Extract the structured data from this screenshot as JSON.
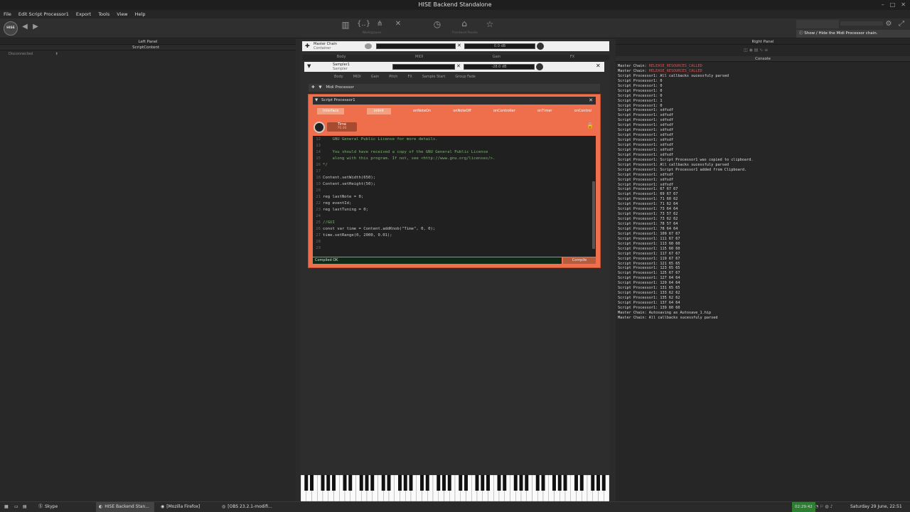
{
  "window": {
    "title": "HISE Backend Standalone"
  },
  "menu": [
    "File",
    "Edit Script Processor1",
    "Export",
    "Tools",
    "View",
    "Help"
  ],
  "toolbar": {
    "logo": "HISE",
    "workspaces_label": "Workspaces",
    "frontend_label": "Frontend Panels",
    "tooltip": "Show / Hide the Midi Processor chain."
  },
  "left_panel": {
    "title": "Left Panel",
    "subtitle": "ScriptContent",
    "status": "Disconnected"
  },
  "right_panel": {
    "title": "Right Panel",
    "console_title": "Console"
  },
  "master_chain": {
    "name": "Master Chain",
    "type": "Container",
    "gain": "0.0 dB",
    "tabs": [
      "Body",
      "MIDI",
      "Gain",
      "FX"
    ]
  },
  "sampler": {
    "name": "Sampler1",
    "type": "Sampler",
    "gain": "-28.0 dB",
    "tabs": [
      "Body",
      "MIDI",
      "Gain",
      "Pitch",
      "FX",
      "Sample Start",
      "Group Fade"
    ]
  },
  "midi_processor": {
    "label": "Midi Processor"
  },
  "script_processor": {
    "name": "Script Processor1",
    "tabs": [
      "Interface",
      "onInit",
      "onNoteOn",
      "onNoteOff",
      "onController",
      "onTimer",
      "onControl"
    ],
    "knob_label": "Time",
    "knob_value": "70.00",
    "status": "Compiled OK",
    "compile_label": "Compile"
  },
  "code_lines": [
    {
      "n": "12",
      "t": "    GNU General Public License for more details.",
      "cls": "c"
    },
    {
      "n": "13",
      "t": "",
      "cls": "c"
    },
    {
      "n": "14",
      "t": "    You should have received a copy of the GNU General Public License",
      "cls": "c"
    },
    {
      "n": "15",
      "t": "    along with this program. If not, see <http://www.gnu.org/licenses/>.",
      "cls": "c"
    },
    {
      "n": "16",
      "t": "*/",
      "cls": "c"
    },
    {
      "n": "17",
      "t": "",
      "cls": "k"
    },
    {
      "n": "18",
      "t": "Content.setWidth(650);",
      "cls": "k"
    },
    {
      "n": "19",
      "t": "Content.setHeight(50);",
      "cls": "k"
    },
    {
      "n": "20",
      "t": "",
      "cls": "k"
    },
    {
      "n": "21",
      "t": "reg lastNote = 0;",
      "cls": "k"
    },
    {
      "n": "22",
      "t": "reg eventId;",
      "cls": "k"
    },
    {
      "n": "23",
      "t": "reg lastTuning = 0;",
      "cls": "k"
    },
    {
      "n": "24",
      "t": "",
      "cls": "k"
    },
    {
      "n": "25",
      "t": "//GUI",
      "cls": "c"
    },
    {
      "n": "26",
      "t": "const var time = Content.addKnob(\"Time\", 0, 0);",
      "cls": "k"
    },
    {
      "n": "27",
      "t": "time.setRange(0, 2000, 0.01);",
      "cls": "k"
    },
    {
      "n": "28",
      "t": "",
      "cls": "k"
    },
    {
      "n": "29",
      "t": "",
      "cls": "k"
    }
  ],
  "console_lines": [
    {
      "t": "Master Chain: ",
      "r": "RELEASE_RESOURCES_CALLED"
    },
    {
      "t": "Master Chain: ",
      "r": "RELEASE_RESOURCES_CALLED"
    },
    {
      "t": "Script Processor1: All callbacks sucessfuly parsed"
    },
    {
      "t": "Script Processor1: 0"
    },
    {
      "t": "Script Processor1: 0"
    },
    {
      "t": "Script Processor1: 0"
    },
    {
      "t": "Script Processor1: 0"
    },
    {
      "t": "Script Processor1: 1"
    },
    {
      "t": "Script Processor1: 0"
    },
    {
      "t": "Script Processor1: sdfsdf"
    },
    {
      "t": "Script Processor1: sdfsdf"
    },
    {
      "t": "Script Processor1: sdfsdf"
    },
    {
      "t": "Script Processor1: sdfsdf"
    },
    {
      "t": "Script Processor1: sdfsdf"
    },
    {
      "t": "Script Processor1: sdfsdf"
    },
    {
      "t": "Script Processor1: sdfsdf"
    },
    {
      "t": "Script Processor1: sdfsdf"
    },
    {
      "t": "Script Processor1: sdfsdf"
    },
    {
      "t": "Script Processor1: sdfsdf"
    },
    {
      "t": "Script Processor1: Script Processor1 was copied to clipboard."
    },
    {
      "t": "Script Processor1: All callbacks sucessfuly parsed"
    },
    {
      "t": "Script Processor1: Script Processor1 added from Clipboard."
    },
    {
      "t": "Script Processor1: sdfsdf"
    },
    {
      "t": "Script Processor1: sdfsdf"
    },
    {
      "t": "Script Processor1: sdfsdf"
    },
    {
      "t": "Script Processor1: 67 67 67"
    },
    {
      "t": "Script Processor1: 69 67 67"
    },
    {
      "t": "Script Processor1: 71 60 62"
    },
    {
      "t": "Script Processor1: 71 62 64"
    },
    {
      "t": "Script Processor1: 73 64 64"
    },
    {
      "t": "Script Processor1: 73 57 62"
    },
    {
      "t": "Script Processor1: 73 62 62"
    },
    {
      "t": "Script Processor1: 78 57 64"
    },
    {
      "t": "Script Processor1: 78 64 64"
    },
    {
      "t": "Script Processor1: 109 67 67"
    },
    {
      "t": "Script Processor1: 111 67 67"
    },
    {
      "t": "Script Processor1: 113 60 60"
    },
    {
      "t": "Script Processor1: 115 60 60"
    },
    {
      "t": "Script Processor1: 117 67 67"
    },
    {
      "t": "Script Processor1: 119 67 67"
    },
    {
      "t": "Script Processor1: 121 65 65"
    },
    {
      "t": "Script Processor1: 123 65 65"
    },
    {
      "t": "Script Processor1: 125 67 67"
    },
    {
      "t": "Script Processor1: 127 64 64"
    },
    {
      "t": "Script Processor1: 129 64 64"
    },
    {
      "t": "Script Processor1: 131 65 65"
    },
    {
      "t": "Script Processor1: 133 62 62"
    },
    {
      "t": "Script Processor1: 135 62 62"
    },
    {
      "t": "Script Processor1: 137 64 64"
    },
    {
      "t": "Script Processor1: 139 60 60"
    },
    {
      "t": "Master Chain: Autosaving as Autosave_1.hip"
    },
    {
      "t": "Master Chain: All callbacks sucessfuly parsed"
    }
  ],
  "taskbar": {
    "tasks": [
      "Skype",
      "HISE Backend Stan...",
      "[Mozilla Firefox]",
      "[OBS 23.2.1-modifi..."
    ],
    "time_badge": "02:29:42",
    "clock": "Saturday 29 June, 22:51"
  },
  "colors": {
    "editor": "#ef6f4c",
    "accent_tab": "#f5a080",
    "background": "#2b2b2b",
    "status_ok": "#0e2a16"
  }
}
